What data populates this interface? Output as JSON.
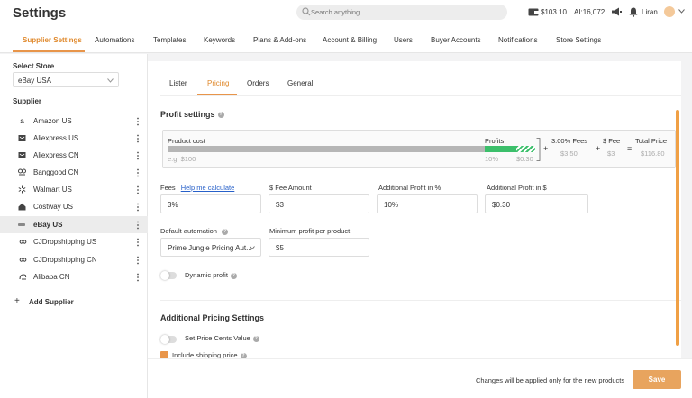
{
  "app": {
    "title": "Settings"
  },
  "search": {
    "placeholder": "Search anything"
  },
  "account": {
    "balance": "$103.10",
    "ai_credits": "AI:16,072",
    "user_name": "Liran"
  },
  "main_nav": {
    "tabs": [
      {
        "label": "Supplier Settings",
        "active": true
      },
      {
        "label": "Automations"
      },
      {
        "label": "Templates"
      },
      {
        "label": "Keywords"
      },
      {
        "label": "Plans & Add-ons"
      },
      {
        "label": "Account & Billing"
      },
      {
        "label": "Users"
      },
      {
        "label": "Buyer Accounts"
      },
      {
        "label": "Notifications"
      },
      {
        "label": "Store Settings"
      }
    ]
  },
  "sidebar": {
    "select_store_label": "Select Store",
    "selected_store": "eBay USA",
    "supplier_label": "Supplier",
    "suppliers": [
      {
        "name": "Amazon US",
        "icon": "amazon-icon"
      },
      {
        "name": "Aliexpress US",
        "icon": "aliexpress-icon"
      },
      {
        "name": "Aliexpress CN",
        "icon": "aliexpress-icon"
      },
      {
        "name": "Banggood CN",
        "icon": "banggood-icon"
      },
      {
        "name": "Walmart US",
        "icon": "walmart-icon"
      },
      {
        "name": "Costway US",
        "icon": "costway-icon"
      },
      {
        "name": "eBay US",
        "icon": "ebay-icon",
        "active": true
      },
      {
        "name": "CJDropshipping US",
        "icon": "cjdropshipping-icon"
      },
      {
        "name": "CJDropshipping CN",
        "icon": "cjdropshipping-icon"
      },
      {
        "name": "Alibaba CN",
        "icon": "alibaba-icon"
      }
    ],
    "add_supplier_label": "Add Supplier"
  },
  "sub_tabs": [
    {
      "label": "Lister"
    },
    {
      "label": "Pricing",
      "active": true
    },
    {
      "label": "Orders"
    },
    {
      "label": "General"
    }
  ],
  "profit_settings": {
    "title": "Profit settings",
    "product_cost_label": "Product cost",
    "product_cost_placeholder": "e.g. $100",
    "profits_label": "Profits",
    "profits_percent": "10%",
    "profits_amount": "$0.30",
    "fees_label": "3.00% Fees",
    "fees_value": "$3.50",
    "fixed_fee_label": "$ Fee",
    "fixed_fee_value": "$3",
    "total_price_label": "Total Price",
    "total_price_value": "$116.80",
    "op_plus": "+",
    "op_equals": "="
  },
  "fields": {
    "fees_label": "Fees",
    "help_link": "Help me calculate",
    "fees_value": "3%",
    "fee_amount_label": "$ Fee Amount",
    "fee_amount_value": "$3",
    "additional_percent_label": "Additional Profit in %",
    "additional_percent_value": "10%",
    "additional_dollar_label": "Additional Profit in $",
    "additional_dollar_value": "$0.30",
    "default_automation_label": "Default automation",
    "default_automation_value": "Prime Jungle Pricing Aut...",
    "min_profit_label": "Minimum profit per product",
    "min_profit_value": "$5",
    "dynamic_profit_label": "Dynamic profit"
  },
  "additional_pricing": {
    "title": "Additional Pricing Settings",
    "set_price_cents_label": "Set Price Cents Value",
    "include_shipping_label": "Include shipping price"
  },
  "footer": {
    "note": "Changes will be applied only for the new products",
    "save_label": "Save"
  },
  "colors": {
    "accent": "#e8954a",
    "profit_green": "#3cbf6b",
    "link": "#2760c9"
  }
}
